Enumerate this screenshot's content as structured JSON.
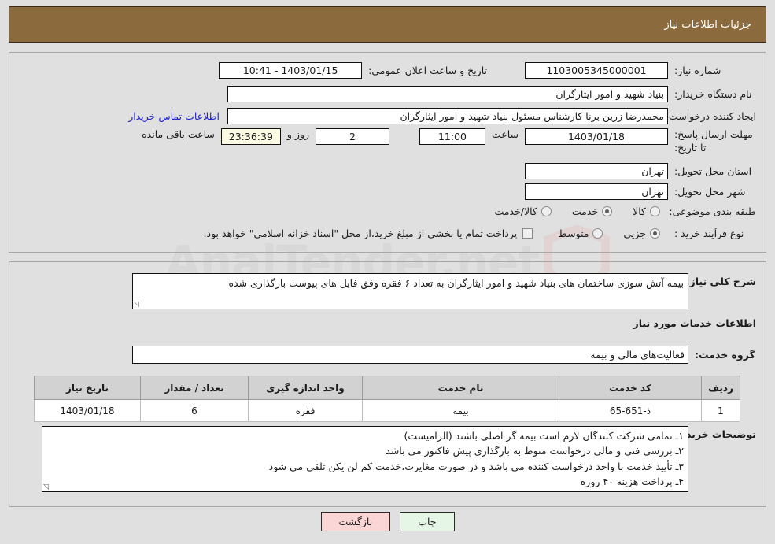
{
  "header": {
    "title": "جزئیات اطلاعات نیاز"
  },
  "watermark": {
    "text_left": "Anal",
    "text_right": "Tender.net",
    "full": "AnalTender.net"
  },
  "form": {
    "need_number_label": "شماره نیاز:",
    "need_number_value": "1103005345000001",
    "announce_datetime_label": "تاریخ و ساعت اعلان عمومی:",
    "announce_datetime_value": "1403/01/15 - 10:41",
    "buyer_org_label": "نام دستگاه خریدار:",
    "buyer_org_value": "بنیاد شهید و امور ایثارگران",
    "requester_label": "ایجاد کننده درخواست:",
    "requester_value": "محمدرضا زرین برنا کارشناس مسئول  بنیاد شهید و امور ایثارگران",
    "contact_link": "اطلاعات تماس خریدار",
    "deadline_label": "مهلت ارسال پاسخ: تا تاریخ:",
    "deadline_date": "1403/01/18",
    "deadline_time_label": "ساعت",
    "deadline_time": "11:00",
    "days_remaining": "2",
    "days_word": "روز و",
    "countdown": "23:36:39",
    "remaining_suffix": "ساعت باقی مانده",
    "province_label": "استان محل تحویل:",
    "province_value": "تهران",
    "city_label": "شهر محل تحویل:",
    "city_value": "تهران",
    "category_label": "طبقه بندی موضوعی:",
    "category_options": [
      {
        "label": "کالا",
        "selected": false
      },
      {
        "label": "خدمت",
        "selected": true
      },
      {
        "label": "کالا/خدمت",
        "selected": false
      }
    ],
    "purchase_type_label": "نوع فرآیند خرید :",
    "purchase_type_options": [
      {
        "label": "جزیی",
        "selected": true
      },
      {
        "label": "متوسط",
        "selected": false
      }
    ],
    "treasury_checkbox_checked": false,
    "treasury_note": "پرداخت تمام یا بخشی از مبلغ خرید،از محل \"اسناد خزانه اسلامی\" خواهد بود."
  },
  "description": {
    "label": "شرح کلی نیاز:",
    "value": "بیمه آتش سوزی ساختمان های بنیاد شهید و امور ایثارگران به تعداد ۶ فقره وفق فایل های پیوست بارگذاری شده"
  },
  "services": {
    "section_title": "اطلاعات خدمات مورد نیاز",
    "group_label": "گروه خدمت:",
    "group_value": "فعالیت‌های مالی و بیمه",
    "table": {
      "columns": [
        "ردیف",
        "کد خدمت",
        "نام خدمت",
        "واحد اندازه گیری",
        "تعداد / مقدار",
        "تاریخ نیاز"
      ],
      "rows": [
        {
          "row_no": "1",
          "service_code": "ذ-651-65",
          "service_name": "بیمه",
          "unit": "فقره",
          "quantity": "6",
          "need_date": "1403/01/18"
        }
      ]
    }
  },
  "buyer_notes": {
    "label": "توضیحات خریدار:",
    "lines": [
      "۱ـ تمامی شرکت کنندگان لازم است بیمه گر اصلی باشند (الزامیست)",
      "۲ـ بررسی فنی و مالی درخواست منوط به بارگذاری پیش فاکتور می باشد",
      "۳ـ تأیید خدمت با واحد درخواست کننده می باشد و در صورت مغایرت،خدمت کم لن یکن تلقی می شود",
      "۴ـ پرداخت هزینه ۴۰ روزه"
    ],
    "text": "۱ـ تمامی شرکت کنندگان لازم است بیمه گر اصلی باشند (الزامیست)\n۲ـ بررسی فنی و مالی درخواست منوط به بارگذاری پیش فاکتور می باشد\n۳ـ تأیید خدمت با واحد درخواست کننده می باشد و در صورت مغایرت،خدمت کم لن یکن تلقی می شود\n۴ـ پرداخت هزینه ۴۰ روزه"
  },
  "buttons": {
    "print": "چاپ",
    "back": "بازگشت"
  },
  "colors": {
    "titlebar": "#8b6b3d",
    "page_background": "#e0e0e0",
    "link": "#2222cc",
    "print_button": "#e6f6e6",
    "back_button": "#fbd6d6",
    "timer_field": "#fbfbe4",
    "table_header": "#d2d2d2"
  }
}
